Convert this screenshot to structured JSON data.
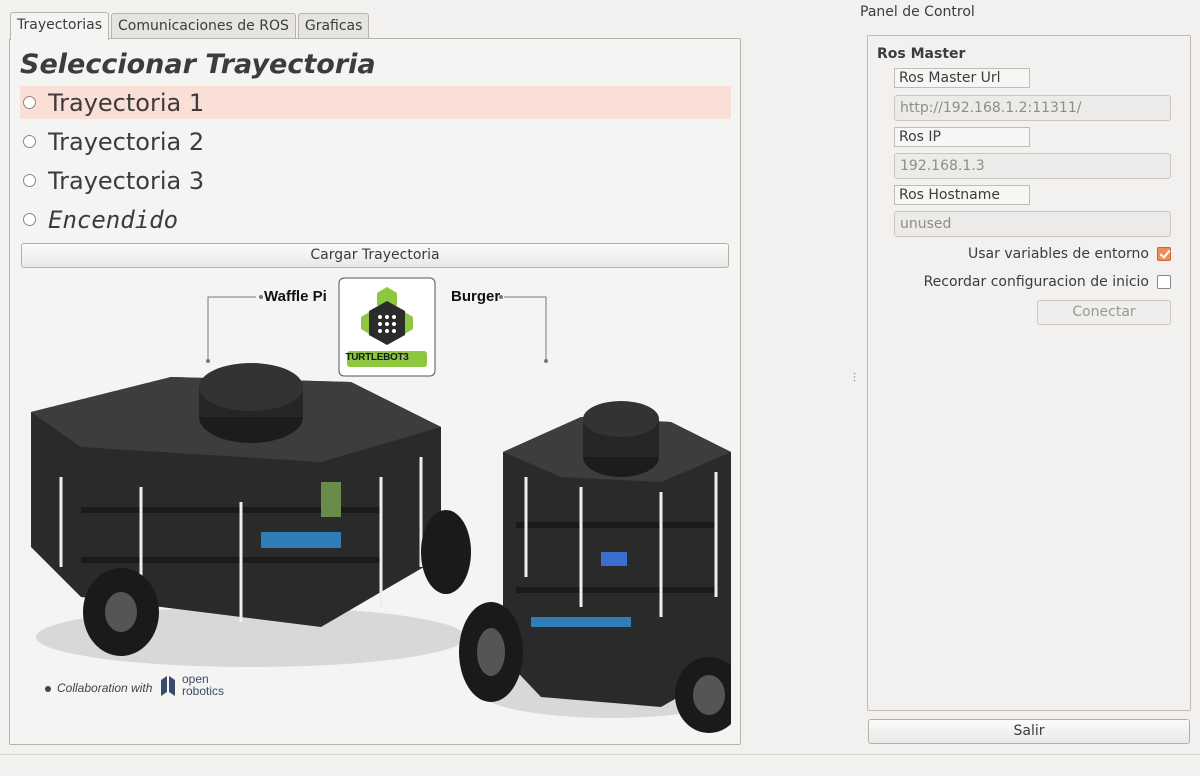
{
  "tabs": [
    {
      "label": "Trayectorias",
      "active": true
    },
    {
      "label": "Comunicaciones de ROS",
      "active": false
    },
    {
      "label": "Graficas",
      "active": false
    }
  ],
  "trajectory": {
    "title": "Seleccionar Trayectoria",
    "options": [
      {
        "label": "Trayectoria 1",
        "selected": false,
        "highlighted": true
      },
      {
        "label": "Trayectoria 2",
        "selected": false
      },
      {
        "label": "Trayectoria 3",
        "selected": false
      },
      {
        "label": "Encendido",
        "selected": false
      }
    ],
    "load_button": "Cargar Trayectoria"
  },
  "robot_image": {
    "label_left": "Waffle Pi",
    "label_right": "Burger",
    "logo_text": "TURTLEBOT3",
    "collab_text": "Collaboration with",
    "collab_logo_top": "open",
    "collab_logo_bottom": "robotics"
  },
  "control_panel": {
    "title": "Panel de Control",
    "group_title": "Ros Master",
    "master_url_label": "Ros Master Url",
    "master_url_value": "http://192.168.1.2:11311/",
    "ros_ip_label": "Ros IP",
    "ros_ip_value": "192.168.1.3",
    "hostname_label": "Ros Hostname",
    "hostname_value": "unused",
    "use_env_label": "Usar variables de entorno",
    "use_env_checked": true,
    "remember_label": "Recordar configuracion de inicio",
    "remember_checked": false,
    "connect_button": "Conectar",
    "exit_button": "Salir"
  },
  "colors": {
    "accent": "#f08b5b",
    "highlight_row": "#fadfd6",
    "logo_green": "#8dc63f"
  }
}
